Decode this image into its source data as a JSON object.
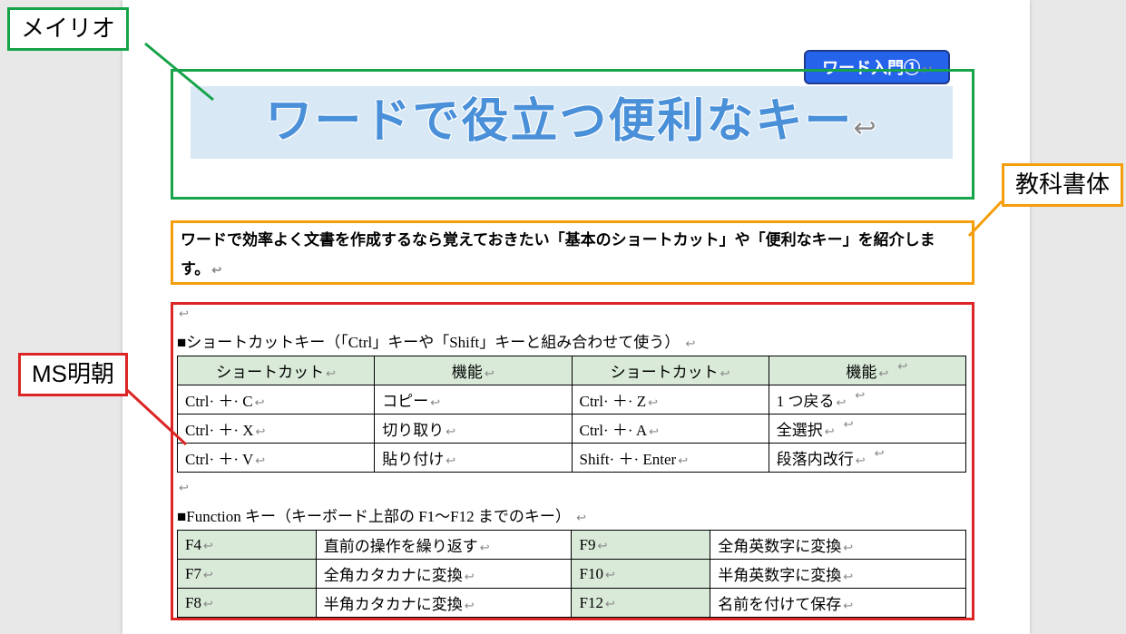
{
  "callouts": {
    "meiryo": "メイリオ",
    "kyokasho": "教科書体",
    "msmincho": "MS明朝"
  },
  "badge": "ワード入門①",
  "title": "ワードで役立つ便利なキー",
  "intro": "ワードで効率よく文書を作成するなら覚えておきたい「基本のショートカット」や「便利なキー」を紹介します。",
  "section1": {
    "heading": "■ショートカットキー（「Ctrl」キーや「Shift」キーと組み合わせて使う）",
    "headers": {
      "sc": "ショートカット",
      "fn": "機能"
    },
    "rows": [
      {
        "k1": "Ctrl· ＋· C",
        "f1": "コピー",
        "k2": "Ctrl· ＋· Z",
        "f2": "1 つ戻る"
      },
      {
        "k1": "Ctrl· ＋· X",
        "f1": "切り取り",
        "k2": "Ctrl· ＋· A",
        "f2": "全選択"
      },
      {
        "k1": "Ctrl· ＋· V",
        "f1": "貼り付け",
        "k2": "Shift· ＋· Enter",
        "f2": "段落内改行"
      }
    ]
  },
  "section2": {
    "heading": "■Function キー（キーボード上部の F1～F12 までのキー）",
    "rows": [
      {
        "k1": "F4",
        "f1": "直前の操作を繰り返す",
        "k2": "F9",
        "f2": "全角英数字に変換"
      },
      {
        "k1": "F7",
        "f1": "全角カタカナに変換",
        "k2": "F10",
        "f2": "半角英数字に変換"
      },
      {
        "k1": "F8",
        "f1": "半角カタカナに変換",
        "k2": "F12",
        "f2": "名前を付けて保存"
      }
    ]
  }
}
